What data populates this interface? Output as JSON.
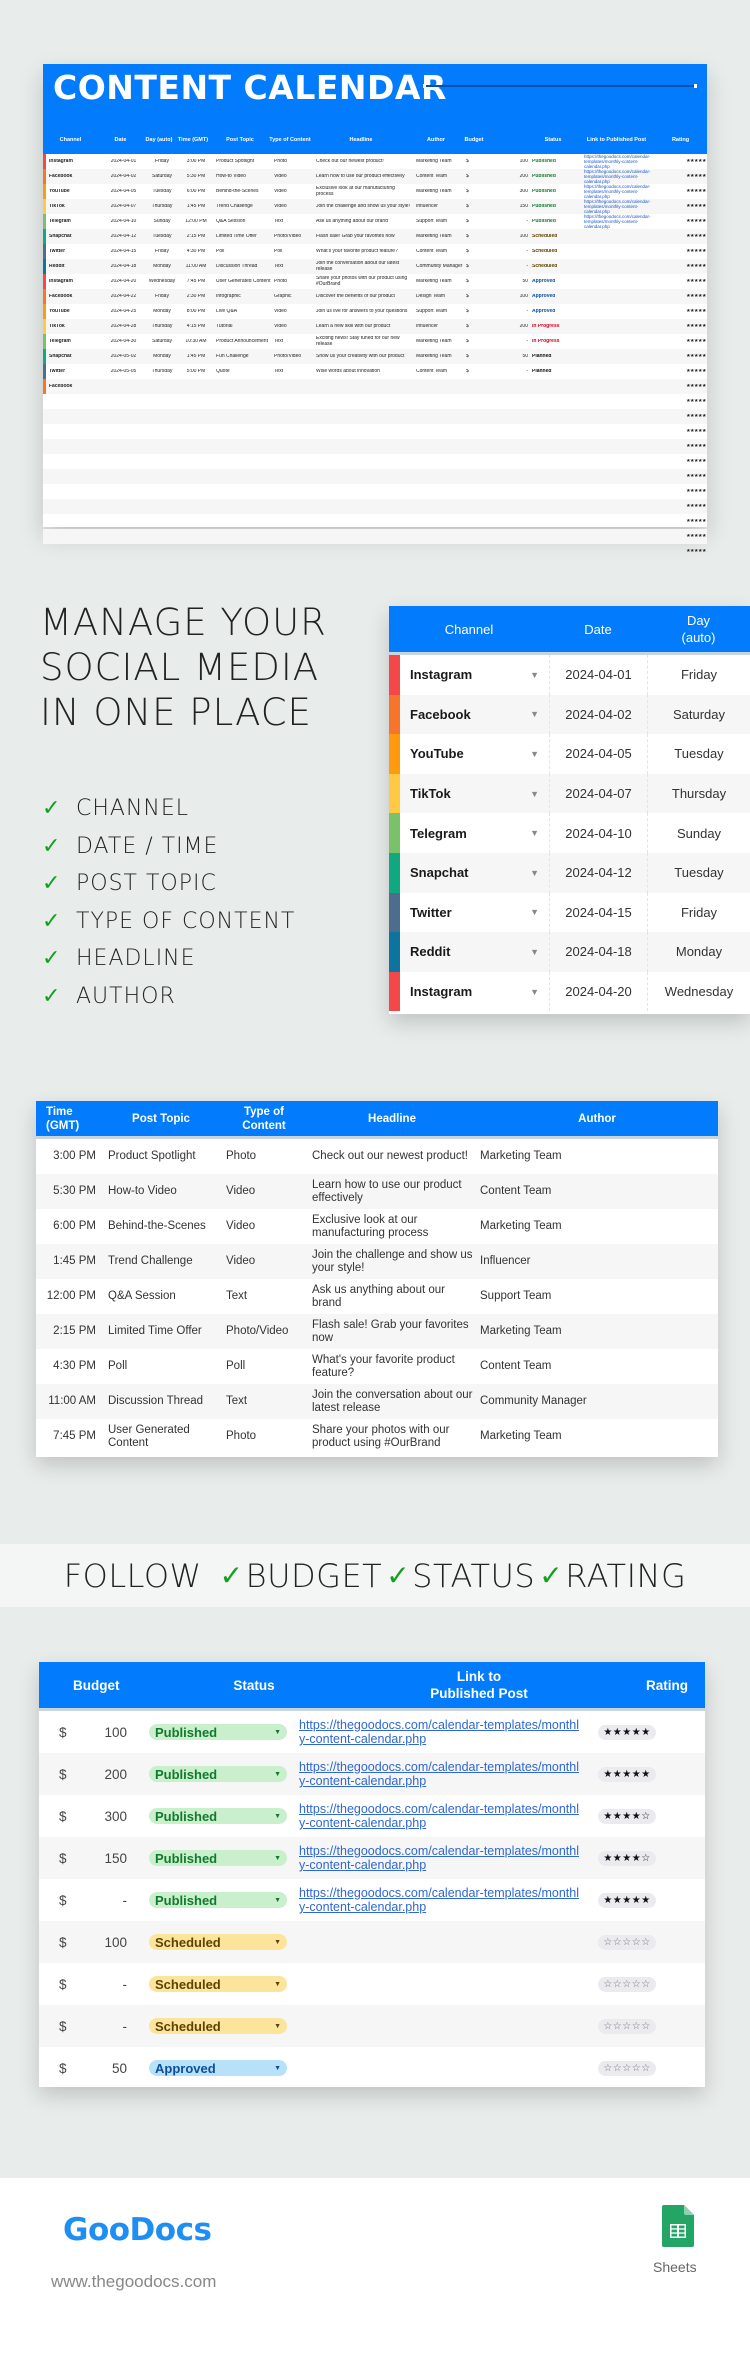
{
  "colors": {
    "accent": "#027cfc",
    "check_green": "#14a01e",
    "channels": {
      "Instagram": "#f44848",
      "Facebook": "#f6752a",
      "YouTube": "#ff9a0e",
      "TikTok": "#ffc944",
      "Telegram": "#7ac26a",
      "Snapchat": "#0fa881",
      "Twitter": "#4c6d8c",
      "Reddit": "#0d74a0"
    },
    "status": {
      "Published": "#127a2e",
      "Scheduled": "#5c4300",
      "Approved": "#0d4f9c",
      "In Progress": "#d0021b",
      "Planned": "#111111"
    }
  },
  "overview": {
    "title": "CONTENT CALENDAR",
    "headers": [
      "Channel",
      "Date",
      "Day (auto)",
      "Time (GMT)",
      "Post Topic",
      "Type of Content",
      "Headline",
      "Author",
      "Budget",
      "",
      "Status",
      "Link to Published Post",
      "Rating"
    ],
    "rows": [
      {
        "channel": "Instagram",
        "date": "2024-04-01",
        "day": "Friday",
        "time": "3:00 PM",
        "topic": "Product Spotlight",
        "type": "Photo",
        "headline": "Check out our newest product!",
        "author": "Marketing Team",
        "currency": "$",
        "budget": "100",
        "status": "Published",
        "link": "https://thegoodocs.com/calendar-templates/monthly-content-calendar.php",
        "stars": "★★★★★"
      },
      {
        "channel": "Facebook",
        "date": "2024-04-02",
        "day": "Saturday",
        "time": "5:30 PM",
        "topic": "How-to Video",
        "type": "Video",
        "headline": "Learn how to use our product effectively",
        "author": "Content Team",
        "currency": "$",
        "budget": "200",
        "status": "Published",
        "link": "https://thegoodocs.com/calendar-templates/monthly-content-calendar.php",
        "stars": "★★★★★"
      },
      {
        "channel": "YouTube",
        "date": "2024-04-05",
        "day": "Tuesday",
        "time": "6:00 PM",
        "topic": "Behind-the-Scenes",
        "type": "Video",
        "headline": "Exclusive look at our manufacturing process",
        "author": "Marketing Team",
        "currency": "$",
        "budget": "300",
        "status": "Published",
        "link": "https://thegoodocs.com/calendar-templates/monthly-content-calendar.php",
        "stars": "★★★★★"
      },
      {
        "channel": "TikTok",
        "date": "2024-04-07",
        "day": "Thursday",
        "time": "1:45 PM",
        "topic": "Trend Challenge",
        "type": "Video",
        "headline": "Join the challenge and show us your style!",
        "author": "Influencer",
        "currency": "$",
        "budget": "150",
        "status": "Published",
        "link": "https://thegoodocs.com/calendar-templates/monthly-content-calendar.php",
        "stars": "★★★★★"
      },
      {
        "channel": "Telegram",
        "date": "2024-04-10",
        "day": "Sunday",
        "time": "12:00 PM",
        "topic": "Q&A Session",
        "type": "Text",
        "headline": "Ask us anything about our brand",
        "author": "Support Team",
        "currency": "$",
        "budget": "-",
        "status": "Published",
        "link": "https://thegoodocs.com/calendar-templates/monthly-content-calendar.php",
        "stars": "★★★★★"
      },
      {
        "channel": "Snapchat",
        "date": "2024-04-12",
        "day": "Tuesday",
        "time": "2:15 PM",
        "topic": "Limited Time Offer",
        "type": "Photo/Video",
        "headline": "Flash sale! Grab your favorites now",
        "author": "Marketing Team",
        "currency": "$",
        "budget": "100",
        "status": "Scheduled",
        "link": "",
        "stars": "★★★★★"
      },
      {
        "channel": "Twitter",
        "date": "2024-04-15",
        "day": "Friday",
        "time": "4:30 PM",
        "topic": "Poll",
        "type": "Poll",
        "headline": "What's your favorite product feature?",
        "author": "Content Team",
        "currency": "$",
        "budget": "-",
        "status": "Scheduled",
        "link": "",
        "stars": "★★★★★"
      },
      {
        "channel": "Reddit",
        "date": "2024-04-18",
        "day": "Monday",
        "time": "11:00 AM",
        "topic": "Discussion Thread",
        "type": "Text",
        "headline": "Join the conversation about our latest release",
        "author": "Community Manager",
        "currency": "$",
        "budget": "-",
        "status": "Scheduled",
        "link": "",
        "stars": "★★★★★"
      },
      {
        "channel": "Instagram",
        "date": "2024-04-20",
        "day": "Wednesday",
        "time": "7:45 PM",
        "topic": "User Generated Content",
        "type": "Photo",
        "headline": "Share your photos with our product using #OurBrand",
        "author": "Marketing Team",
        "currency": "$",
        "budget": "50",
        "status": "Approved",
        "link": "",
        "stars": "★★★★★"
      },
      {
        "channel": "Facebook",
        "date": "2024-04-22",
        "day": "Friday",
        "time": "2:30 PM",
        "topic": "Infographic",
        "type": "Graphic",
        "headline": "Discover the benefits of our product",
        "author": "Design Team",
        "currency": "$",
        "budget": "100",
        "status": "Approved",
        "link": "",
        "stars": "★★★★★"
      },
      {
        "channel": "YouTube",
        "date": "2024-04-25",
        "day": "Monday",
        "time": "8:00 PM",
        "topic": "Live Q&A",
        "type": "Video",
        "headline": "Join us live for answers to your questions",
        "author": "Support Team",
        "currency": "$",
        "budget": "-",
        "status": "Approved",
        "link": "",
        "stars": "★★★★★"
      },
      {
        "channel": "TikTok",
        "date": "2024-04-28",
        "day": "Thursday",
        "time": "4:15 PM",
        "topic": "Tutorial",
        "type": "Video",
        "headline": "Learn a new skill with our product",
        "author": "Influencer",
        "currency": "$",
        "budget": "200",
        "status": "In Progress",
        "link": "",
        "stars": "★★★★★"
      },
      {
        "channel": "Telegram",
        "date": "2024-04-30",
        "day": "Saturday",
        "time": "10:30 AM",
        "topic": "Product Announcement",
        "type": "Text",
        "headline": "Exciting news! Stay tuned for our new release",
        "author": "Marketing Team",
        "currency": "$",
        "budget": "-",
        "status": "In Progress",
        "link": "",
        "stars": "★★★★★"
      },
      {
        "channel": "Snapchat",
        "date": "2024-05-02",
        "day": "Monday",
        "time": "1:45 PM",
        "topic": "Fun Challenge",
        "type": "Photo/Video",
        "headline": "Show us your creativity with our product",
        "author": "Marketing Team",
        "currency": "$",
        "budget": "50",
        "status": "Planned",
        "link": "",
        "stars": "★★★★★"
      },
      {
        "channel": "Twitter",
        "date": "2024-05-05",
        "day": "Thursday",
        "time": "5:00 PM",
        "topic": "Quote",
        "type": "Text",
        "headline": "Wise words about innovation",
        "author": "Content Team",
        "currency": "$",
        "budget": "-",
        "status": "Planned",
        "link": "",
        "stars": "★★★★★"
      },
      {
        "channel": "Facebook",
        "date": "",
        "day": "",
        "time": "",
        "topic": "",
        "type": "",
        "headline": "",
        "author": "",
        "currency": "",
        "budget": "",
        "status": "",
        "link": "",
        "stars": "★★★★★"
      }
    ],
    "empty_rows": 11,
    "empty_row_stars": "★★★★★"
  },
  "manage": {
    "title_lines": [
      "MANAGE YOUR",
      "SOCIAL MEDIA",
      "IN ONE PLACE"
    ],
    "checklist": [
      "CHANNEL",
      "DATE / TIME",
      "POST TOPIC",
      "TYPE OF CONTENT",
      "HEADLINE",
      "AUTHOR"
    ],
    "check_glyph": "✓",
    "table": {
      "headers": [
        "Channel",
        "Date",
        "Day\n(auto)"
      ],
      "rows": [
        {
          "channel": "Instagram",
          "date": "2024-04-01",
          "day": "Friday"
        },
        {
          "channel": "Facebook",
          "date": "2024-04-02",
          "day": "Saturday"
        },
        {
          "channel": "YouTube",
          "date": "2024-04-05",
          "day": "Tuesday"
        },
        {
          "channel": "TikTok",
          "date": "2024-04-07",
          "day": "Thursday"
        },
        {
          "channel": "Telegram",
          "date": "2024-04-10",
          "day": "Sunday"
        },
        {
          "channel": "Snapchat",
          "date": "2024-04-12",
          "day": "Tuesday"
        },
        {
          "channel": "Twitter",
          "date": "2024-04-15",
          "day": "Friday"
        },
        {
          "channel": "Reddit",
          "date": "2024-04-18",
          "day": "Monday"
        },
        {
          "channel": "Instagram",
          "date": "2024-04-20",
          "day": "Wednesday"
        }
      ]
    }
  },
  "content_table": {
    "headers": [
      "Time (GMT)",
      "Post Topic",
      "Type of\nContent",
      "Headline",
      "Author"
    ],
    "rows": [
      {
        "time": "3:00 PM",
        "topic": "Product Spotlight",
        "type": "Photo",
        "headline": "Check out our newest product!",
        "author": "Marketing Team"
      },
      {
        "time": "5:30 PM",
        "topic": "How-to Video",
        "type": "Video",
        "headline": "Learn how to use our product effectively",
        "author": "Content Team"
      },
      {
        "time": "6:00 PM",
        "topic": "Behind-the-Scenes",
        "type": "Video",
        "headline": "Exclusive look at our manufacturing process",
        "author": "Marketing Team"
      },
      {
        "time": "1:45 PM",
        "topic": "Trend Challenge",
        "type": "Video",
        "headline": "Join the challenge and show us your style!",
        "author": "Influencer"
      },
      {
        "time": "12:00 PM",
        "topic": "Q&A Session",
        "type": "Text",
        "headline": "Ask us anything about our brand",
        "author": "Support Team"
      },
      {
        "time": "2:15 PM",
        "topic": "Limited Time Offer",
        "type": "Photo/Video",
        "headline": "Flash sale! Grab your favorites now",
        "author": "Marketing Team"
      },
      {
        "time": "4:30 PM",
        "topic": "Poll",
        "type": "Poll",
        "headline": "What's your favorite product feature?",
        "author": "Content Team"
      },
      {
        "time": "11:00 AM",
        "topic": "Discussion Thread",
        "type": "Text",
        "headline": "Join the conversation about our latest release",
        "author": "Community Manager"
      },
      {
        "time": "7:45 PM",
        "topic": "User Generated Content",
        "type": "Photo",
        "headline": "Share your photos with our product using #OurBrand",
        "author": "Marketing Team"
      }
    ]
  },
  "follow": {
    "lead": "FOLLOW",
    "items": [
      "BUDGET",
      "STATUS",
      "RATING"
    ],
    "check_glyph": "✓"
  },
  "budget_table": {
    "headers": [
      "Budget",
      "Status",
      "Link to\nPublished Post",
      "Rating"
    ],
    "rows": [
      {
        "currency": "$",
        "budget": "100",
        "status": "Published",
        "link": "https://thegoodocs.com/calendar-templates/monthly-content-calendar.php",
        "rating": 5
      },
      {
        "currency": "$",
        "budget": "200",
        "status": "Published",
        "link": "https://thegoodocs.com/calendar-templates/monthly-content-calendar.php",
        "rating": 5
      },
      {
        "currency": "$",
        "budget": "300",
        "status": "Published",
        "link": "https://thegoodocs.com/calendar-templates/monthly-content-calendar.php",
        "rating": 4
      },
      {
        "currency": "$",
        "budget": "150",
        "status": "Published",
        "link": "https://thegoodocs.com/calendar-templates/monthly-content-calendar.php",
        "rating": 4
      },
      {
        "currency": "$",
        "budget": "-",
        "status": "Published",
        "link": "https://thegoodocs.com/calendar-templates/monthly-content-calendar.php",
        "rating": 5
      },
      {
        "currency": "$",
        "budget": "100",
        "status": "Scheduled",
        "link": "",
        "rating": 0
      },
      {
        "currency": "$",
        "budget": "-",
        "status": "Scheduled",
        "link": "",
        "rating": 0
      },
      {
        "currency": "$",
        "budget": "-",
        "status": "Scheduled",
        "link": "",
        "rating": 0
      },
      {
        "currency": "$",
        "budget": "50",
        "status": "Approved",
        "link": "",
        "rating": 0
      }
    ],
    "dropdown_glyph": "▼"
  },
  "footer": {
    "brand": "GooDocs",
    "url": "www.thegoodocs.com",
    "app_label": "Sheets"
  }
}
